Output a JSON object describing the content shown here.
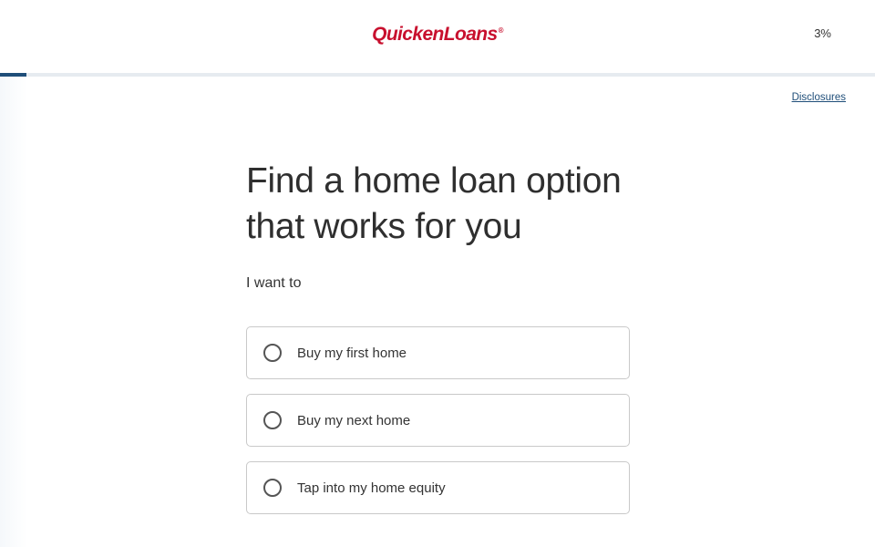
{
  "header": {
    "logo_text": "QuickenLoans",
    "logo_mark": "®",
    "progress_text": "3%",
    "progress_fraction": 0.03
  },
  "links": {
    "disclosures": "Disclosures"
  },
  "main": {
    "title": "Find a home loan option that works for you",
    "subtitle": "I want to",
    "options": [
      {
        "label": "Buy my first home",
        "selected": false
      },
      {
        "label": "Buy my next home",
        "selected": false
      },
      {
        "label": "Tap into my home equity",
        "selected": false
      }
    ]
  },
  "colors": {
    "brand": "#c8102e",
    "accent": "#1f4e79"
  }
}
